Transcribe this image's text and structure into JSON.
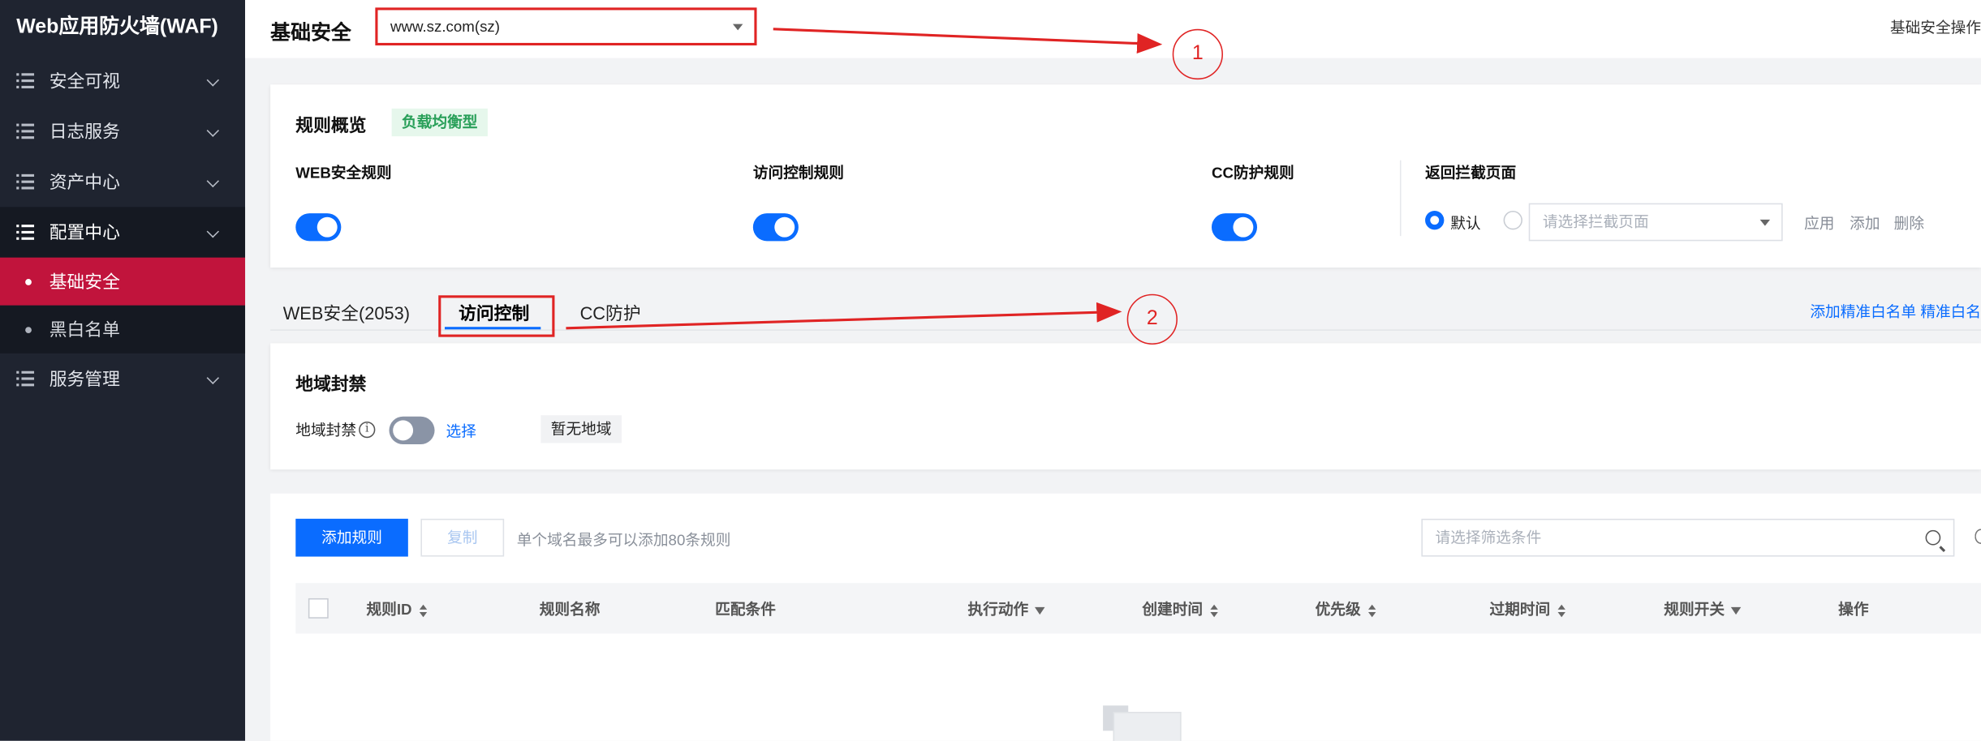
{
  "app": {
    "brand": "Web应用防火墙(WAF)"
  },
  "sidebar": {
    "items": [
      {
        "label": "安全可视"
      },
      {
        "label": "日志服务"
      },
      {
        "label": "资产中心"
      },
      {
        "label": "配置中心"
      },
      {
        "label": "基础安全"
      },
      {
        "label": "黑白名单"
      },
      {
        "label": "服务管理"
      }
    ]
  },
  "header": {
    "title": "基础安全",
    "domain_value": "www.sz.com(sz)",
    "right_text": "基础安全操作"
  },
  "overview": {
    "title": "规则概览",
    "mode_tag": "负载均衡型",
    "web_rule": "WEB安全规则",
    "acl_rule": "访问控制规则",
    "cc_rule": "CC防护规则",
    "block_page_title": "返回拦截页面",
    "default_label": "默认",
    "page_placeholder": "请选择拦截页面",
    "apply": "应用",
    "add": "添加",
    "delete": "删除"
  },
  "tabs": {
    "web": "WEB安全(2053)",
    "acl": "访问控制",
    "cc": "CC防护",
    "right_links": "添加精准白名单  精准白名"
  },
  "geo": {
    "title": "地域封禁",
    "label": "地域封禁",
    "info": "i",
    "select": "选择",
    "none": "暂无地域"
  },
  "rules": {
    "add_button": "添加规则",
    "copy_button": "复制",
    "hint": "单个域名最多可以添加80条规则",
    "search_placeholder": "请选择筛选条件",
    "columns": [
      "规则ID",
      "规则名称",
      "匹配条件",
      "执行动作",
      "创建时间",
      "优先级",
      "过期时间",
      "规则开关",
      "操作"
    ]
  },
  "annotations": {
    "one": "1",
    "two": "2"
  },
  "colors": {
    "accent": "#0a6cff",
    "sidebar_active": "#c1143c",
    "annotation": "#e02424"
  }
}
